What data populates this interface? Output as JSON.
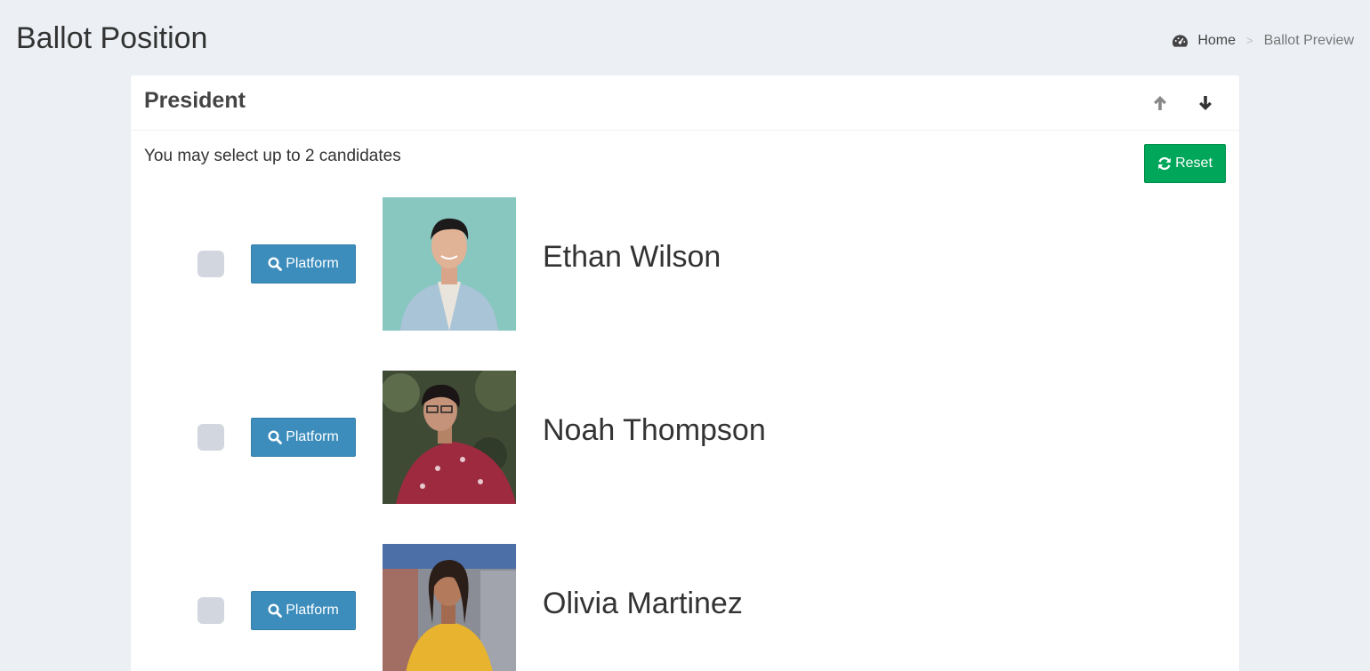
{
  "header": {
    "title": "Ballot Position",
    "breadcrumb": {
      "home": "Home",
      "separator": ">",
      "current": "Ballot Preview"
    }
  },
  "position": {
    "title": "President",
    "instruction": "You may select up to 2 candidates",
    "reset_label": "Reset"
  },
  "candidates": [
    {
      "name": "Ethan Wilson",
      "platform_label": "Platform"
    },
    {
      "name": "Noah Thompson",
      "platform_label": "Platform"
    },
    {
      "name": "Olivia Martinez",
      "platform_label": "Platform"
    }
  ],
  "icons": {
    "breadcrumb_home": "dashboard-icon",
    "move_up": "arrow-up-icon",
    "move_down": "arrow-down-icon",
    "reset": "refresh-icon",
    "platform": "search-icon"
  },
  "colors": {
    "background": "#ecf0f5",
    "primary": "#3c8dbc",
    "success": "#00a65a",
    "checkbox": "#d2d6de"
  }
}
